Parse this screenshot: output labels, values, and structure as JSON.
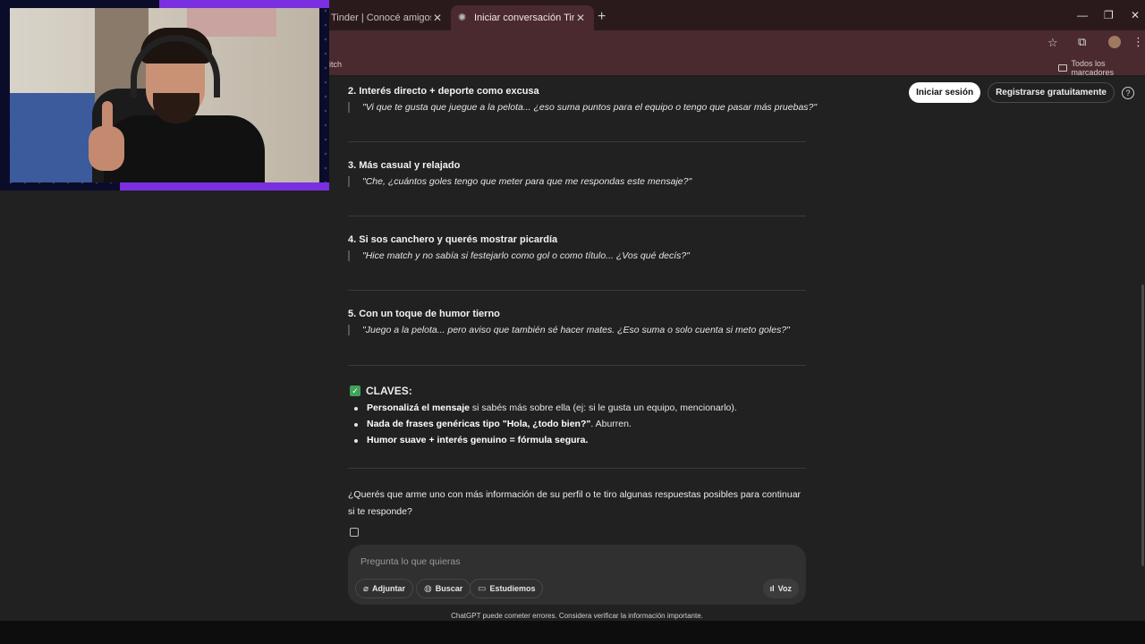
{
  "browser": {
    "tabs": [
      {
        "label": "Tinder | Conocé amigos y gente",
        "active": false
      },
      {
        "label": "Iniciar conversación Tinder",
        "active": true
      }
    ],
    "bookmarks_left": "itch",
    "bookmarks_right": "Todos los marcadores"
  },
  "header": {
    "login": "Iniciar sesión",
    "register": "Registrarse gratuitamente",
    "help": "?"
  },
  "sections": [
    {
      "title": "2. Interés directo + deporte como excusa",
      "quote": "\"Vi que te gusta que juegue a la pelota... ¿eso suma puntos para el equipo o tengo que pasar más pruebas?\""
    },
    {
      "title": "3. Más casual y relajado",
      "quote": "\"Che, ¿cuántos goles tengo que meter para que me respondas este mensaje?\""
    },
    {
      "title": "4. Si sos canchero y querés mostrar picardía",
      "quote": "\"Hice match y no sabía si festejarlo como gol o como título... ¿Vos qué decís?\""
    },
    {
      "title": "5. Con un toque de humor tierno",
      "quote": "\"Juego a la pelota... pero aviso que también sé hacer mates. ¿Eso suma o solo cuenta si meto goles?\""
    }
  ],
  "claves": {
    "title": "CLAVES:",
    "items": [
      {
        "bold": "Personalizá el mensaje",
        "rest": " si sabés más sobre ella (ej: si le gusta un equipo, mencionarlo)."
      },
      {
        "bold": "Nada de frases genéricas tipo \"Hola, ¿todo bien?\"",
        "rest": ". Aburren."
      },
      {
        "bold": "Humor suave + interés genuino = fórmula segura.",
        "rest": ""
      }
    ]
  },
  "question": "¿Querés que arme uno con más información de su perfil o te tiro algunas respuestas posibles para continuar si te responde?",
  "composer": {
    "placeholder": "Pregunta lo que quieras",
    "attach": "Adjuntar",
    "search": "Buscar",
    "study": "Estudiemos",
    "voice": "Voz"
  },
  "footer": "ChatGPT puede cometer errores. Considera verificar la información importante.",
  "colors": {
    "accent_purple": "#7a2fe0",
    "check_green": "#3fa35a",
    "tab_bar": "#4a2a2e"
  }
}
